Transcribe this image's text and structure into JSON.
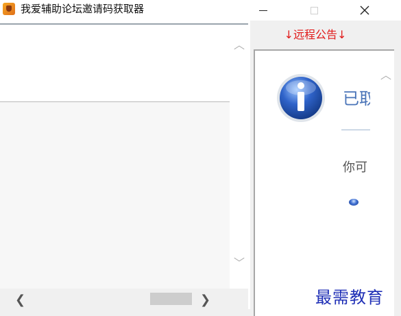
{
  "window": {
    "title": "我爱辅助论坛邀请码获取器",
    "app_icon": "fox-app-icon"
  },
  "left_pane": {
    "vscroll_up": "︿",
    "vscroll_down": "﹀",
    "hscroll_left": "❮",
    "hscroll_right": "❯"
  },
  "right_pane": {
    "notice_title": "↓远程公告↓",
    "heading": "已取",
    "text": "你可",
    "vscroll_up": "︿"
  },
  "watermark": "最需教育",
  "colors": {
    "notice_red": "#e11919",
    "ie_heading_blue": "#4a74b8",
    "watermark_blue": "#1f2fb6"
  }
}
